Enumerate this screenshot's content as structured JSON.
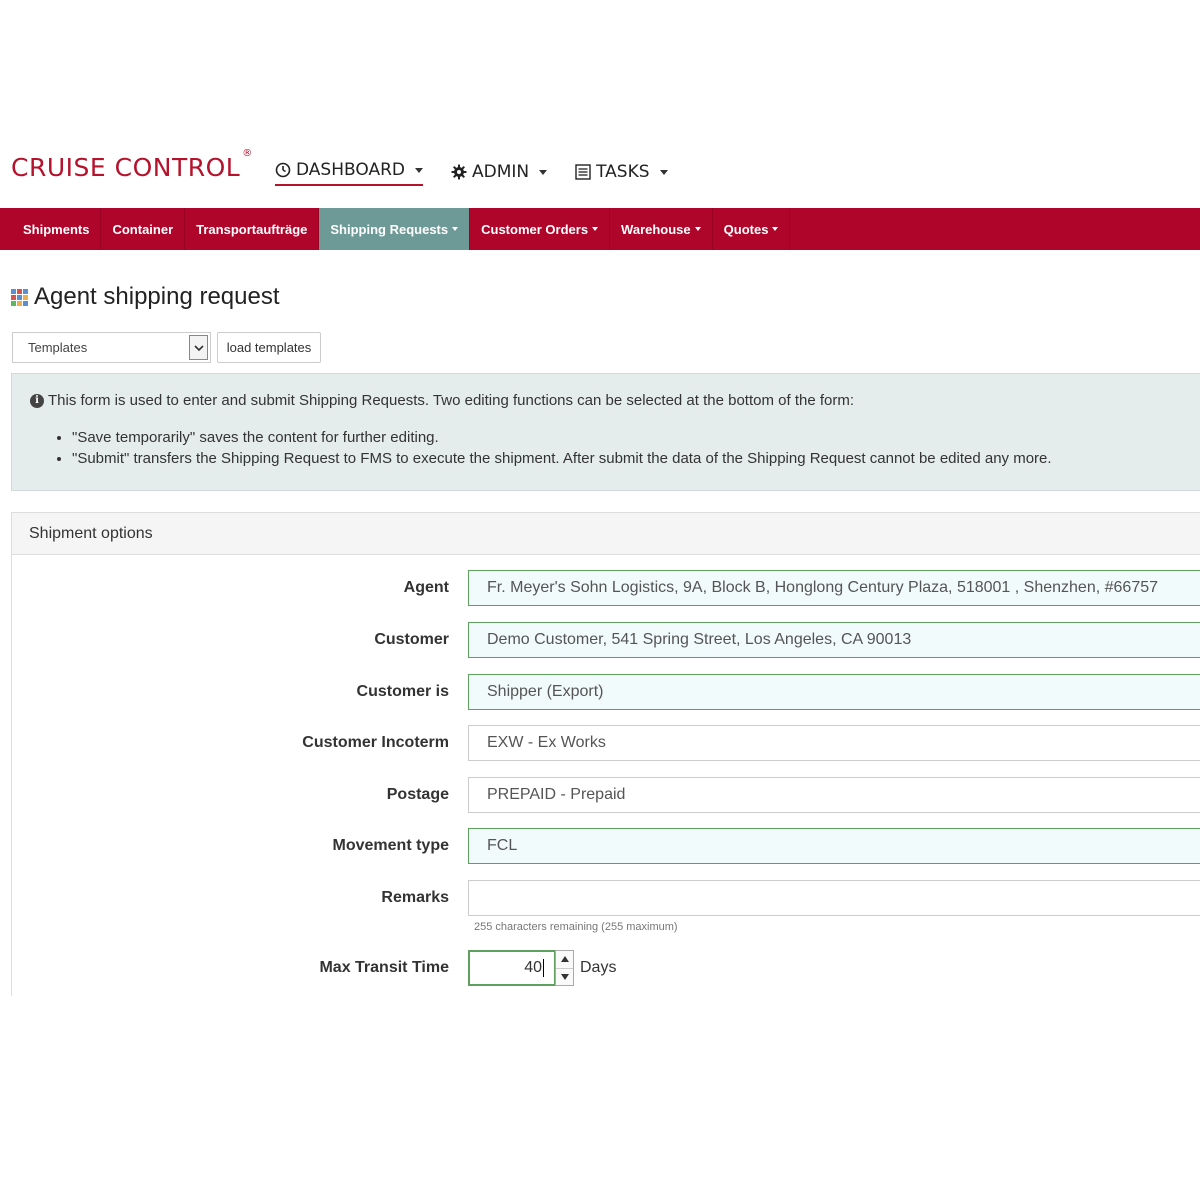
{
  "brand": {
    "name": "CRUISE CONTROL",
    "mark": "®"
  },
  "topnav": [
    {
      "label": "DASHBOARD",
      "icon": "dashboard-icon"
    },
    {
      "label": "ADMIN",
      "icon": "gear-icon"
    },
    {
      "label": "TASKS",
      "icon": "list-icon"
    }
  ],
  "mainnav": [
    {
      "label": "Shipments"
    },
    {
      "label": "Container"
    },
    {
      "label": "Transportaufträge"
    },
    {
      "label": "Shipping Requests"
    },
    {
      "label": "Customer Orders"
    },
    {
      "label": "Warehouse"
    },
    {
      "label": "Quotes"
    }
  ],
  "page": {
    "title": "Agent shipping request"
  },
  "templates": {
    "select_value": "Templates",
    "load_label": "load templates"
  },
  "info": {
    "text": "This form is used to enter and submit Shipping Requests. Two editing functions can be selected at the bottom of the form:",
    "bullets": [
      "\"Save temporarily\" saves the content for further editing.",
      "\"Submit\" transfers the Shipping Request to FMS to execute the shipment. After submit the data of the Shipping Request cannot be edited any more."
    ]
  },
  "panel": {
    "title": "Shipment options",
    "fields": {
      "agent": {
        "label": "Agent",
        "value": "Fr. Meyer's Sohn Logistics, 9A, Block B, Honglong Century Plaza, 518001 , Shenzhen, #66757"
      },
      "customer": {
        "label": "Customer",
        "value": "Demo Customer, 541 Spring Street, Los Angeles, CA 90013"
      },
      "customer_is": {
        "label": "Customer is",
        "value": "Shipper (Export)"
      },
      "incoterm": {
        "label": "Customer Incoterm",
        "value": "EXW - Ex Works"
      },
      "postage": {
        "label": "Postage",
        "value": "PREPAID - Prepaid"
      },
      "movement": {
        "label": "Movement type",
        "value": "FCL"
      },
      "remarks": {
        "label": "Remarks",
        "value": "",
        "hint": "255 characters remaining (255 maximum)"
      },
      "transit": {
        "label": "Max Transit Time",
        "value": "40",
        "unit": "Days"
      }
    }
  },
  "colors": {
    "brand": "#b5122c",
    "navbar": "#b0052a",
    "nav_active": "#6d9a96",
    "valid_border": "#5ea05e"
  }
}
